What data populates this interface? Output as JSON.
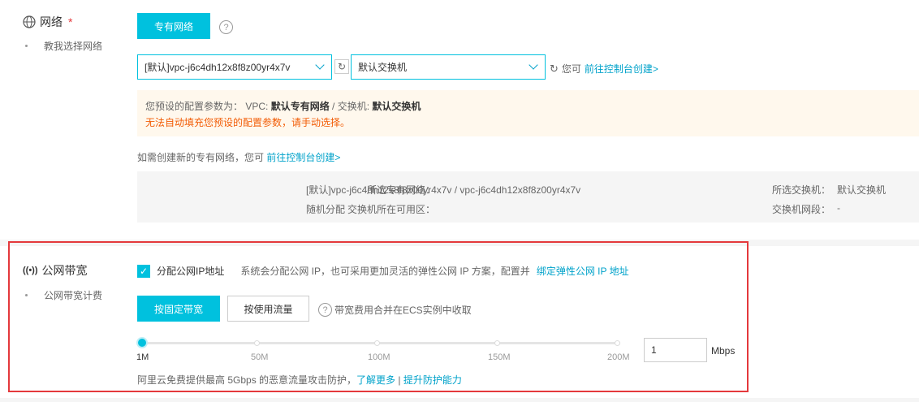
{
  "network": {
    "title": "网络",
    "required_mark": "*",
    "help_link": "教我选择网络",
    "type_button": "专有网络",
    "help_icon": "?",
    "vpc_select": "[默认]vpc-j6c4dh12x8f8z00yr4x7v",
    "vswitch_select": "默认交换机",
    "create_hint_prefix": "您可",
    "create_link": "前往控制台创建>",
    "notice": {
      "line1_prefix": "您预设的配置参数为：  VPC:",
      "vpc_value": "默认专有网络",
      "line1_mid": "/ 交换机:",
      "vswitch_value": "默认交换机",
      "line2": "无法自动填充您预设的配置参数，请手动选择。"
    },
    "new_vpc_hint": "如需创建新的专有网络，您可",
    "new_vpc_link": "前往控制台创建>",
    "summary": {
      "vpc_label": "所选专有网络：",
      "vpc_value": "[默认]vpc-j6c4dh12x8f8z00yr4x7v / vpc-j6c4dh12x8f8z00yr4x7v",
      "zone_label": "交换机所在可用区：",
      "zone_value": "随机分配",
      "vswitch_label": "所选交换机：",
      "vswitch_value": "默认交换机",
      "cidr_label": "交换机网段：",
      "cidr_value": "-"
    }
  },
  "bandwidth": {
    "title": "公网带宽",
    "sub_label": "公网带宽计费",
    "checkbox_label": "分配公网IP地址",
    "checkbox_checked": true,
    "checkbox_hint": "系统会分配公网 IP，也可采用更加灵活的弹性公网 IP 方案，配置并",
    "eip_link": "绑定弹性公网 IP 地址",
    "fixed_button": "按固定带宽",
    "traffic_button": "按使用流量",
    "fee_hint": "带宽费用合并在ECS实例中收取",
    "slider_ticks": [
      "1M",
      "50M",
      "100M",
      "150M",
      "200M"
    ],
    "slider_value_fraction": 0,
    "input_value": "1",
    "unit": "Mbps",
    "ddos_text": "阿里云免费提供最高 5Gbps 的恶意流量攻击防护，",
    "learn_more": "了解更多",
    "separator": "|",
    "upgrade_link": "提升防护能力"
  },
  "colors": {
    "accent": "#00c1de",
    "link": "#00a2ca",
    "warning": "#f25b04",
    "highlight_border": "#e4393c"
  }
}
